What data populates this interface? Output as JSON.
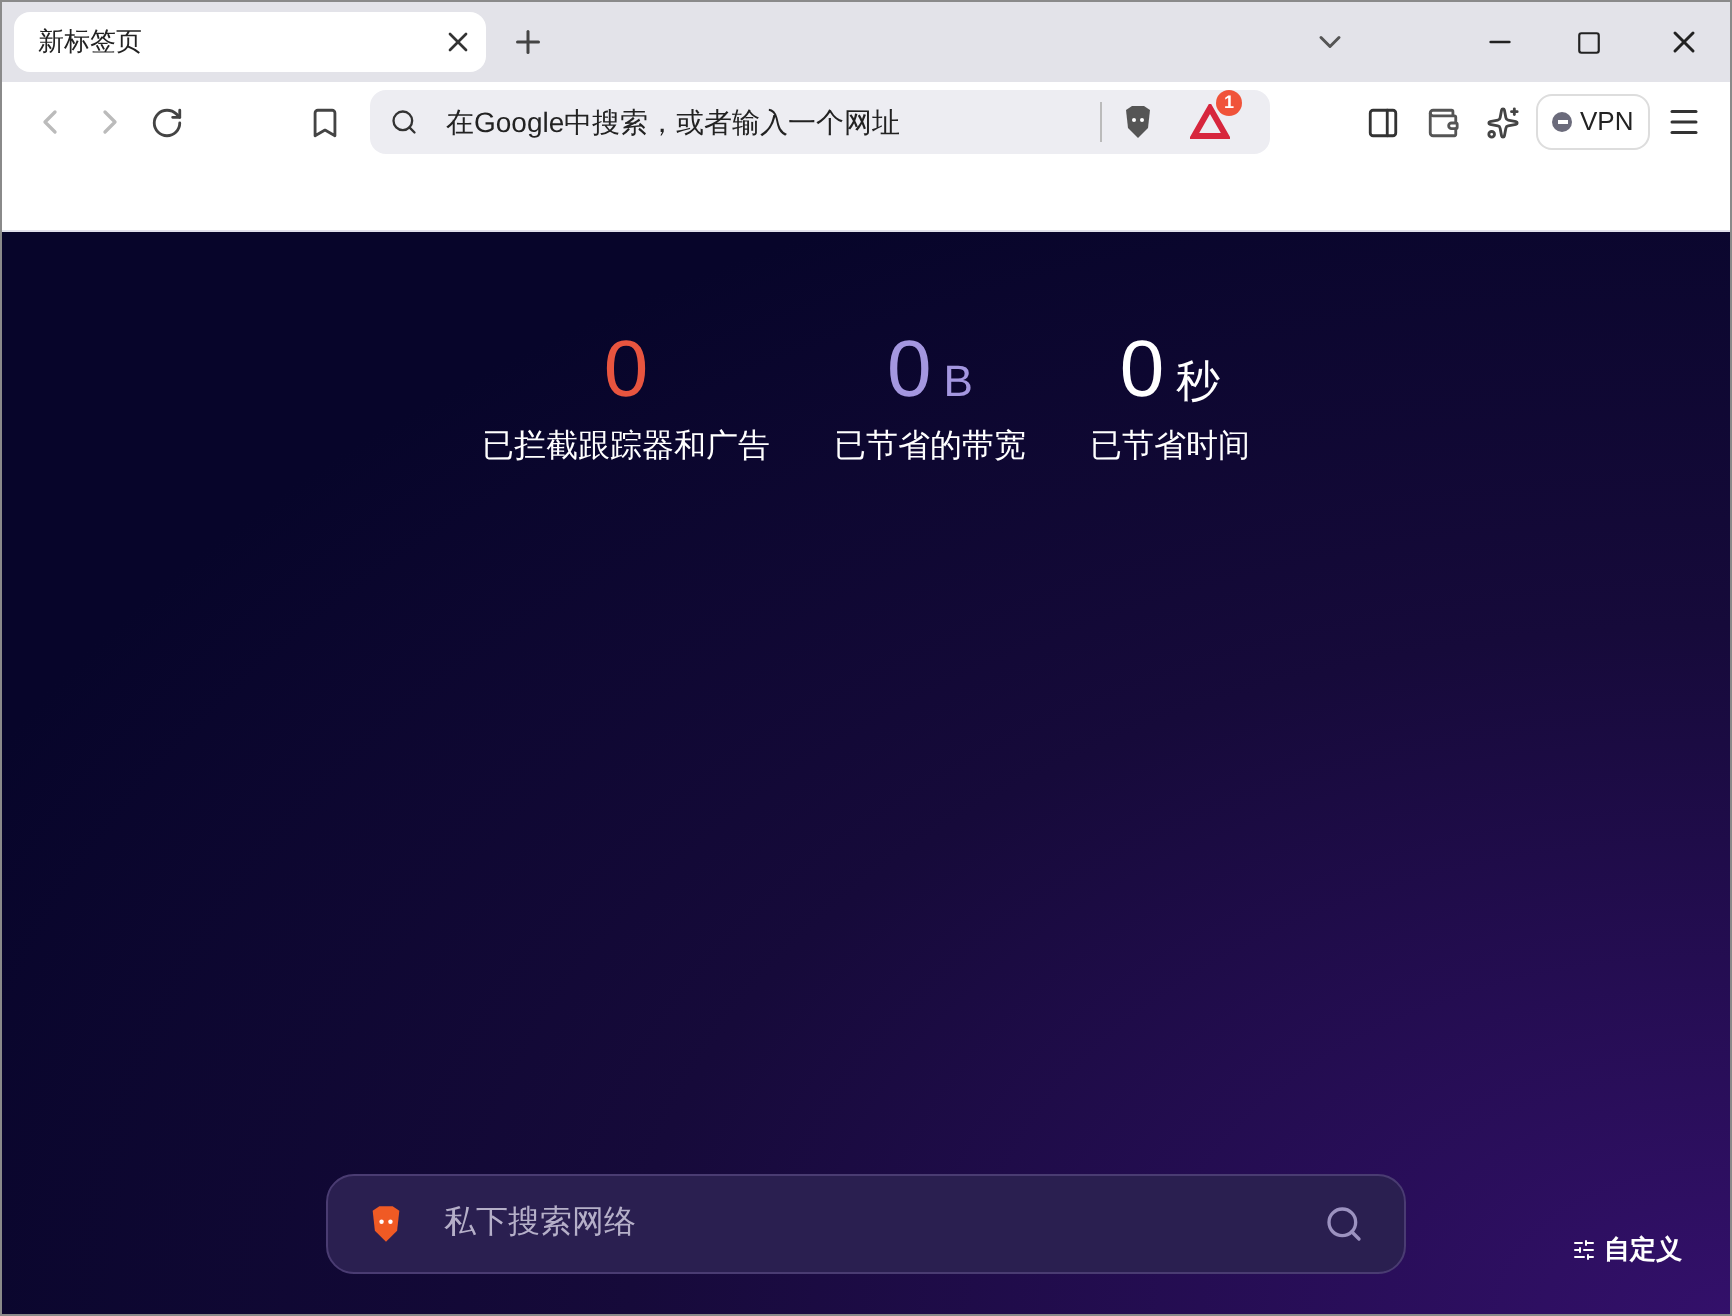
{
  "tab": {
    "title": "新标签页",
    "selected": true
  },
  "address_bar": {
    "placeholder": "在Google中搜索，或者输入一个网址",
    "notification_count": "1"
  },
  "vpn_button": {
    "label": "VPN",
    "on": false
  },
  "stats": [
    {
      "value": "0",
      "label": "已拦截跟踪器和广告",
      "color": "#e8553f"
    },
    {
      "value": "0",
      "unit": "B",
      "label": "已节省的带宽",
      "color": "#a497e0"
    },
    {
      "value": "0",
      "unit": "秒",
      "label": "已节省时间",
      "color": "#ffffff"
    }
  ],
  "search": {
    "placeholder": "私下搜索网络"
  },
  "customize_button": {
    "label": "自定义"
  }
}
